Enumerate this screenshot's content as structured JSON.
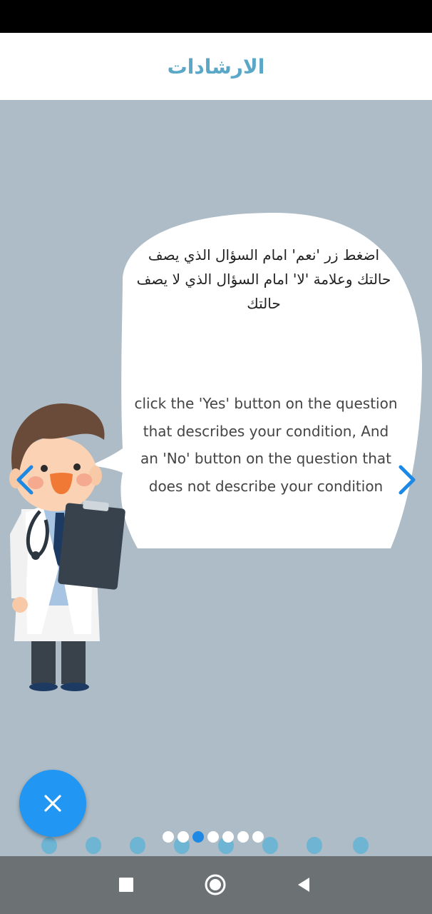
{
  "header": {
    "title": "الارشادات"
  },
  "slide": {
    "arabic_text": "اضغط زر 'نعم' امام السؤال الذي يصف حالتك وعلامة 'لا' امام السؤال الذي لا يصف حالتك",
    "english_text": "click the 'Yes' button on the question that describes your condition, And an  'No' button on the question that does not describe your condition"
  },
  "icons": {
    "prev": "chevron-left-icon",
    "next": "chevron-right-icon",
    "close": "close-icon",
    "nav_recents": "square-icon",
    "nav_home": "circle-icon",
    "nav_back": "triangle-back-icon"
  },
  "pager": {
    "total": 7,
    "active_index": 2
  },
  "colors": {
    "accent": "#2196f3",
    "title": "#5aa7c7",
    "background": "#adbcc6",
    "chevron": "#1e88e5"
  }
}
